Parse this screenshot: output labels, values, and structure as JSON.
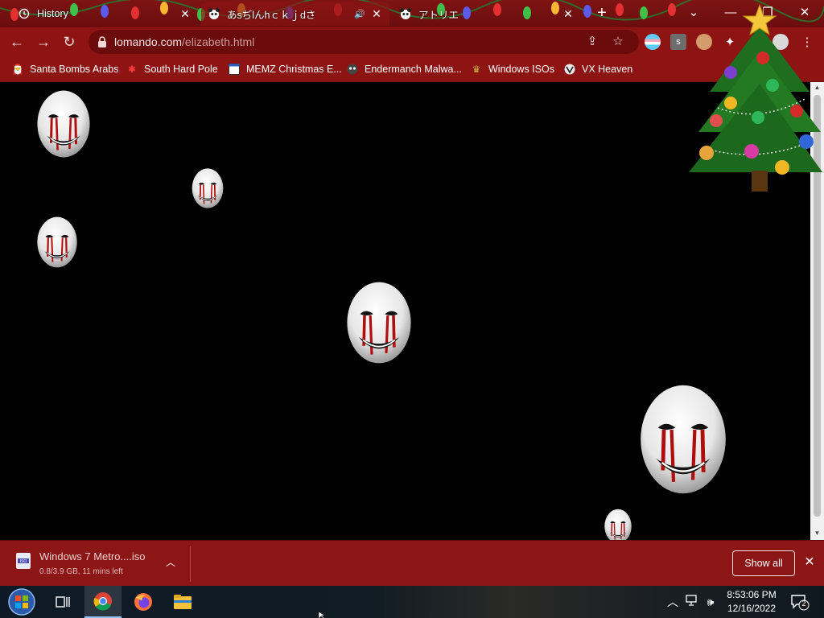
{
  "tabs": [
    {
      "label": "History",
      "close": "✕"
    },
    {
      "label": "あsぢlんhｃｋｊdさ",
      "close": "✕"
    },
    {
      "label": "アトリエ",
      "close": "✕"
    }
  ],
  "new_tab": "+",
  "window": {
    "tab_search": "⌄",
    "minimize": "—",
    "restore": "❐",
    "close": "✕"
  },
  "address": {
    "host": "lomando.com",
    "path": "/elizabeth.html"
  },
  "bookmarks": [
    {
      "label": "Santa Bombs Arabs"
    },
    {
      "label": "South Hard Pole"
    },
    {
      "label": "MEMZ Christmas E..."
    },
    {
      "label": "Endermanch Malwa..."
    },
    {
      "label": "Windows ISOs"
    },
    {
      "label": "VX Heaven"
    }
  ],
  "extensions": {
    "s_label": "s"
  },
  "download": {
    "filename": "Windows 7 Metro....iso",
    "status": "0.8/3.9 GB, 11 mins left",
    "show_all": "Show all"
  },
  "taskbar": {
    "time": "8:53:06 PM",
    "date": "12/16/2022",
    "notification_count": "2"
  },
  "colors": {
    "browser_theme": "#8e1414",
    "tab_strip": "#7e1414",
    "page_background": "#000000"
  }
}
